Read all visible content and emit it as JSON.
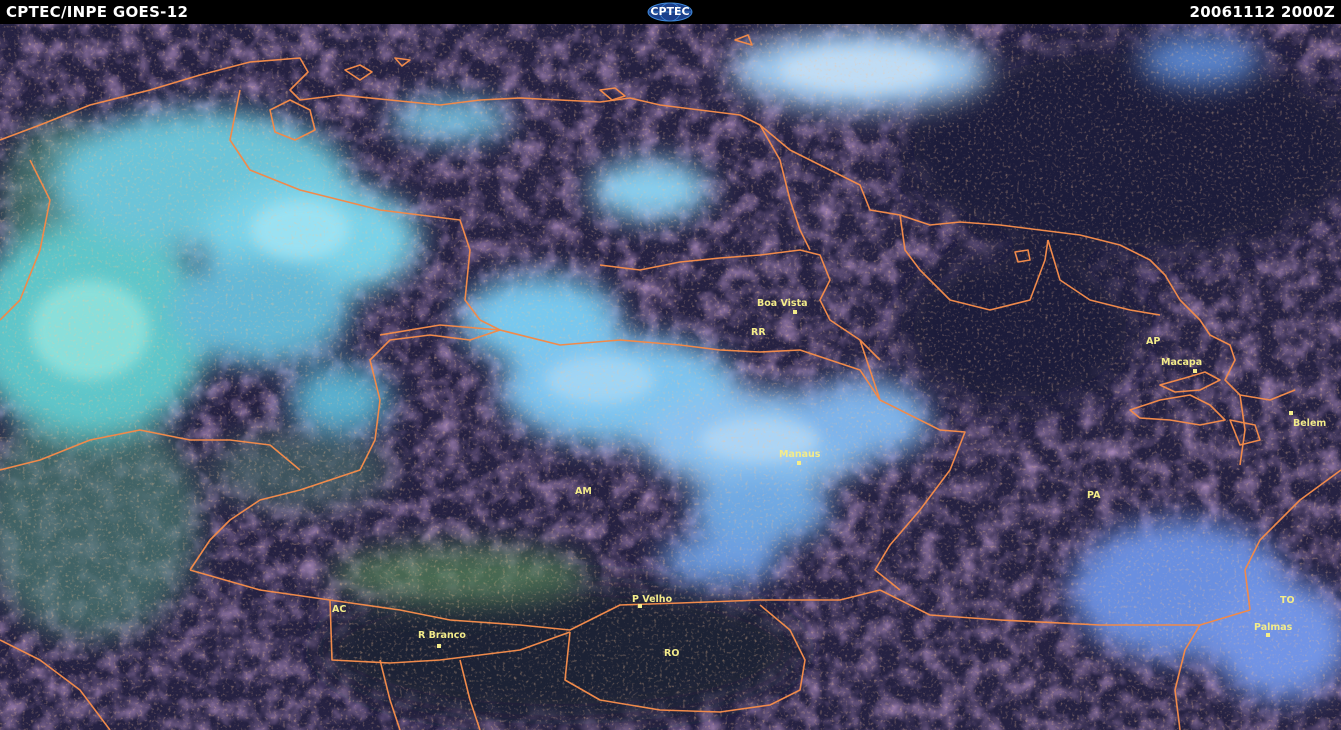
{
  "header": {
    "source_label": "CPTEC/INPE GOES-12",
    "logo_text": "CPTEC",
    "datetime_label": "20061112 2000Z"
  },
  "colors": {
    "header_background": "#000000",
    "header_text": "#ffffff",
    "background_ocean_land": "#262243",
    "clouds_cold": "#7fd9f2",
    "clouds_warm": "#5a3a6e",
    "borders": "#f08a4b",
    "labels": "#f4ec8a"
  },
  "cities": [
    {
      "id": "boa-vista",
      "label": "Boa Vista"
    },
    {
      "id": "manaus",
      "label": "Manaus"
    },
    {
      "id": "macapa",
      "label": "Macapa"
    },
    {
      "id": "belem",
      "label": "Belem"
    },
    {
      "id": "p-velho",
      "label": "P Velho"
    },
    {
      "id": "r-branco",
      "label": "R Branco"
    },
    {
      "id": "palmas",
      "label": "Palmas"
    }
  ],
  "states": [
    {
      "id": "rr",
      "label": "RR"
    },
    {
      "id": "ap",
      "label": "AP"
    },
    {
      "id": "am",
      "label": "AM"
    },
    {
      "id": "pa",
      "label": "PA"
    },
    {
      "id": "ac",
      "label": "AC"
    },
    {
      "id": "ro",
      "label": "RO"
    },
    {
      "id": "to",
      "label": "TO"
    }
  ]
}
